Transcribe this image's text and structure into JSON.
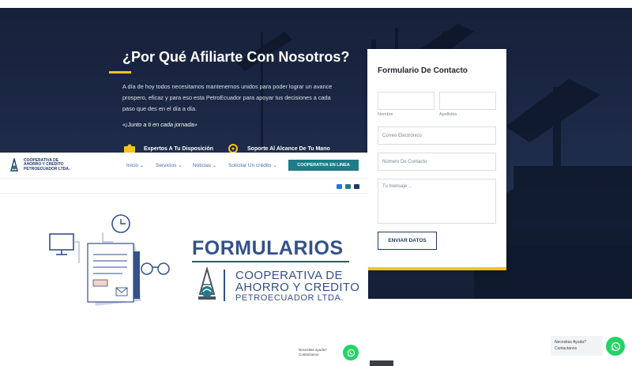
{
  "hero": {
    "title": "¿Por Qué Afiliarte Con Nosotros?",
    "text": "A día de hoy todos necesitamos mantenernos unidos para poder lograr un avance prospero, eficaz y para eso esta PetroEcuador para apoyar tus decisiones a cada paso que des en el día a día.",
    "quote": "«¡Junto a ti en cada jornada»",
    "features": [
      {
        "label": "Expertos A Tu Disposición",
        "icon": "team-icon"
      },
      {
        "label": "Soporte Al Alcance De Tu Mano",
        "icon": "support-icon"
      }
    ]
  },
  "contact_form": {
    "title": "Formulario De Contacto",
    "nombre_label": "Nombre",
    "apellidos_label": "Apellidos",
    "email_placeholder": "Correo Electrónico",
    "phone_placeholder": "Número De Contacto",
    "message_placeholder": "Tu mensaje ...",
    "submit_label": "ENVIAR DATOS"
  },
  "overlay": {
    "logo_line1": "COOPERATIVA DE",
    "logo_line2": "AHORRO Y CREDITO",
    "logo_line3": "PETROECUADOR LTDA.",
    "nav": [
      {
        "label": "Inicio ⌄"
      },
      {
        "label": "Servicios ⌄"
      },
      {
        "label": "Noticias ⌄"
      },
      {
        "label": "Solicitar Un crédito ⌄"
      }
    ],
    "cta_label": "COOPERATIVA EN LINEA",
    "social_icons": [
      "facebook-icon",
      "instagram-icon",
      "youtube-icon"
    ],
    "banner_title": "FORMULARIOS",
    "banner_line1": "COOPERATIVA DE",
    "banner_line2": "AHORRO Y CREDITO",
    "banner_line3": "PETROECUADOR LTDA.",
    "help_line1": "Necesitas ayuda?",
    "help_line2": "Contactanos"
  },
  "help_widget": {
    "line1": "Necesitas Ayuda?",
    "line2": "Contactanos"
  },
  "colors": {
    "accent": "#f5c518",
    "brand_blue": "#1f3869",
    "teal": "#1e7c87",
    "whatsapp": "#25d366"
  }
}
